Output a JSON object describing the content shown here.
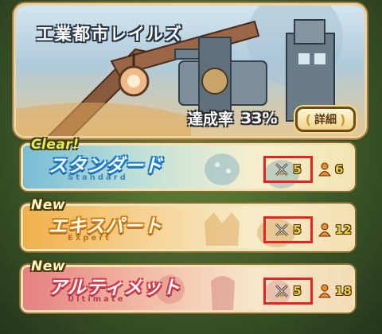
{
  "stage": {
    "title": "工業都市レイルズ",
    "completion_label": "達成率",
    "completion_value": "33%",
    "details_label": "詳細"
  },
  "modes": [
    {
      "badge": "Clear!",
      "name": "スタンダード",
      "subtitle": "Standard",
      "stamina_cost": "5",
      "player_count": "6"
    },
    {
      "badge": "New",
      "name": "エキスパート",
      "subtitle": "Expert",
      "stamina_cost": "5",
      "player_count": "12"
    },
    {
      "badge": "New",
      "name": "アルティメット",
      "subtitle": "Ultimate",
      "stamina_cost": "5",
      "player_count": "18"
    }
  ],
  "icons": {
    "stamina": "crossed-swords-icon",
    "players": "person-icon"
  },
  "colors": {
    "highlight": "#e8221e",
    "standard_accent": "#1d7ec9",
    "expert_accent": "#d07c10",
    "ultimate_accent": "#d33b4e"
  }
}
